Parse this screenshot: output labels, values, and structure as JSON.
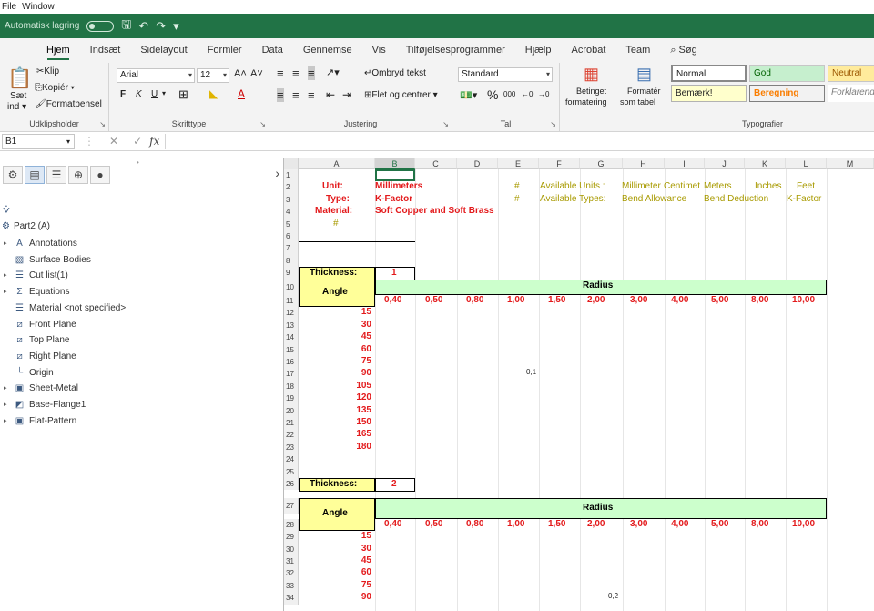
{
  "outer_menu": [
    "File",
    "Window"
  ],
  "qat": {
    "autosave": "Automatisk lagring"
  },
  "tabs": [
    "Hjem",
    "Indsæt",
    "Sidelayout",
    "Formler",
    "Data",
    "Gennemse",
    "Vis",
    "Tilføjelsesprogrammer",
    "Hjælp",
    "Acrobat",
    "Team"
  ],
  "search": "Søg",
  "ribbon": {
    "clipboard": {
      "paste": "Sæt",
      "paste2": "ind",
      "cut": "Klip",
      "copy": "Kopiér",
      "format_painter": "Formatpensel",
      "label": "Udklipsholder"
    },
    "font": {
      "name": "Arial",
      "size": "12",
      "label": "Skrifttype"
    },
    "alignment": {
      "wrap": "Ombryd tekst",
      "merge": "Flet og centrer",
      "label": "Justering"
    },
    "number": {
      "format": "Standard",
      "label": "Tal"
    },
    "styles": {
      "cond": "Betinget",
      "cond2": "formatering",
      "table": "Formatér",
      "table2": "som tabel",
      "normal": "Normal",
      "good": "God",
      "neutral": "Neutral",
      "note": "Bemærk!",
      "calc": "Beregning",
      "explain": "Forklarende",
      "label": "Typografier"
    }
  },
  "formula": {
    "namebox": "B1"
  },
  "tree": {
    "part": "Part2  (A)",
    "items": [
      "Annotations",
      "Surface Bodies",
      "Cut list(1)",
      "Equations",
      "Material <not specified>",
      "Front Plane",
      "Top Plane",
      "Right Plane",
      "Origin",
      "Sheet-Metal",
      "Base-Flange1",
      "Flat-Pattern"
    ]
  },
  "sheet": {
    "columns": [
      "A",
      "B",
      "C",
      "D",
      "E",
      "F",
      "G",
      "H",
      "I",
      "J",
      "K",
      "L",
      "M"
    ],
    "rows": [
      "1",
      "2",
      "3",
      "4",
      "5",
      "6",
      "7",
      "8",
      "9",
      "10",
      "11",
      "12",
      "13",
      "14",
      "15",
      "16",
      "17",
      "18",
      "19",
      "20",
      "21",
      "22",
      "23",
      "24",
      "25",
      "26",
      "27",
      "28",
      "29",
      "30",
      "31",
      "32",
      "33",
      "34"
    ],
    "unit_label": "Unit:",
    "unit_value": "Millimeters",
    "type_label": "Type:",
    "type_value": "K-Factor",
    "material_label": "Material:",
    "material_value": "Soft Copper and Soft Brass",
    "hash": "#",
    "avail_units_label": "Available Units :",
    "avail_types_label": "Available Types:",
    "units": [
      "Millimeter",
      "Centimet",
      "Meters",
      "Inches",
      "Feet"
    ],
    "types": [
      "Bend Allowance",
      "Bend Deduction",
      "K-Factor"
    ],
    "thickness_label": "Thickness:",
    "thickness1": "1",
    "thickness2": "2",
    "angle_label": "Angle",
    "radius_label": "Radius",
    "radii": [
      "0,40",
      "0,50",
      "0,80",
      "1,00",
      "1,50",
      "2,00",
      "3,00",
      "4,00",
      "5,00",
      "8,00",
      "10,00"
    ],
    "angles": [
      "15",
      "30",
      "45",
      "60",
      "75",
      "90",
      "105",
      "120",
      "135",
      "150",
      "165",
      "180"
    ],
    "angles2": [
      "15",
      "30",
      "45",
      "60",
      "75",
      "90"
    ],
    "val1": "0,1",
    "val2": "0,2"
  }
}
